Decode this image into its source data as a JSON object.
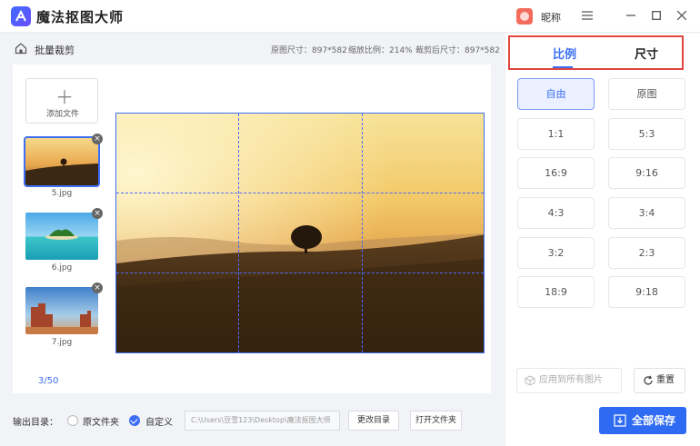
{
  "app": {
    "title": "魔法抠图大师",
    "nickname": "昵称"
  },
  "toolbar": {
    "breadcrumb": "批量裁剪",
    "original_size": "原图尺寸：897*582",
    "zoom": "缩放比例：214%",
    "cropped_size": "裁剪后尺寸：897*582"
  },
  "files": {
    "add_label": "添加文件",
    "items": [
      {
        "name": "5.jpg",
        "selected": true
      },
      {
        "name": "6.jpg",
        "selected": false
      },
      {
        "name": "7.jpg",
        "selected": false
      }
    ],
    "page_count": "3/50"
  },
  "output": {
    "label": "输出目录：",
    "option_original": "原文件夹",
    "option_custom": "自定义",
    "path": "C:\\Users\\豆雪123\\Desktop\\魔法抠图大师",
    "change_dir": "更改目录",
    "open_folder": "打开文件夹"
  },
  "panel": {
    "tabs": [
      "比例",
      "尺寸"
    ],
    "ratios": [
      "自由",
      "原图",
      "1:1",
      "5:3",
      "16:9",
      "9:16",
      "4:3",
      "3:4",
      "3:2",
      "2:3",
      "18:9",
      "9:18"
    ],
    "apply_all": "应用到所有图片",
    "reset": "重置",
    "save_all": "全部保存"
  },
  "colors": {
    "accent": "#3d6ff5",
    "highlight_box": "#e0463d"
  }
}
